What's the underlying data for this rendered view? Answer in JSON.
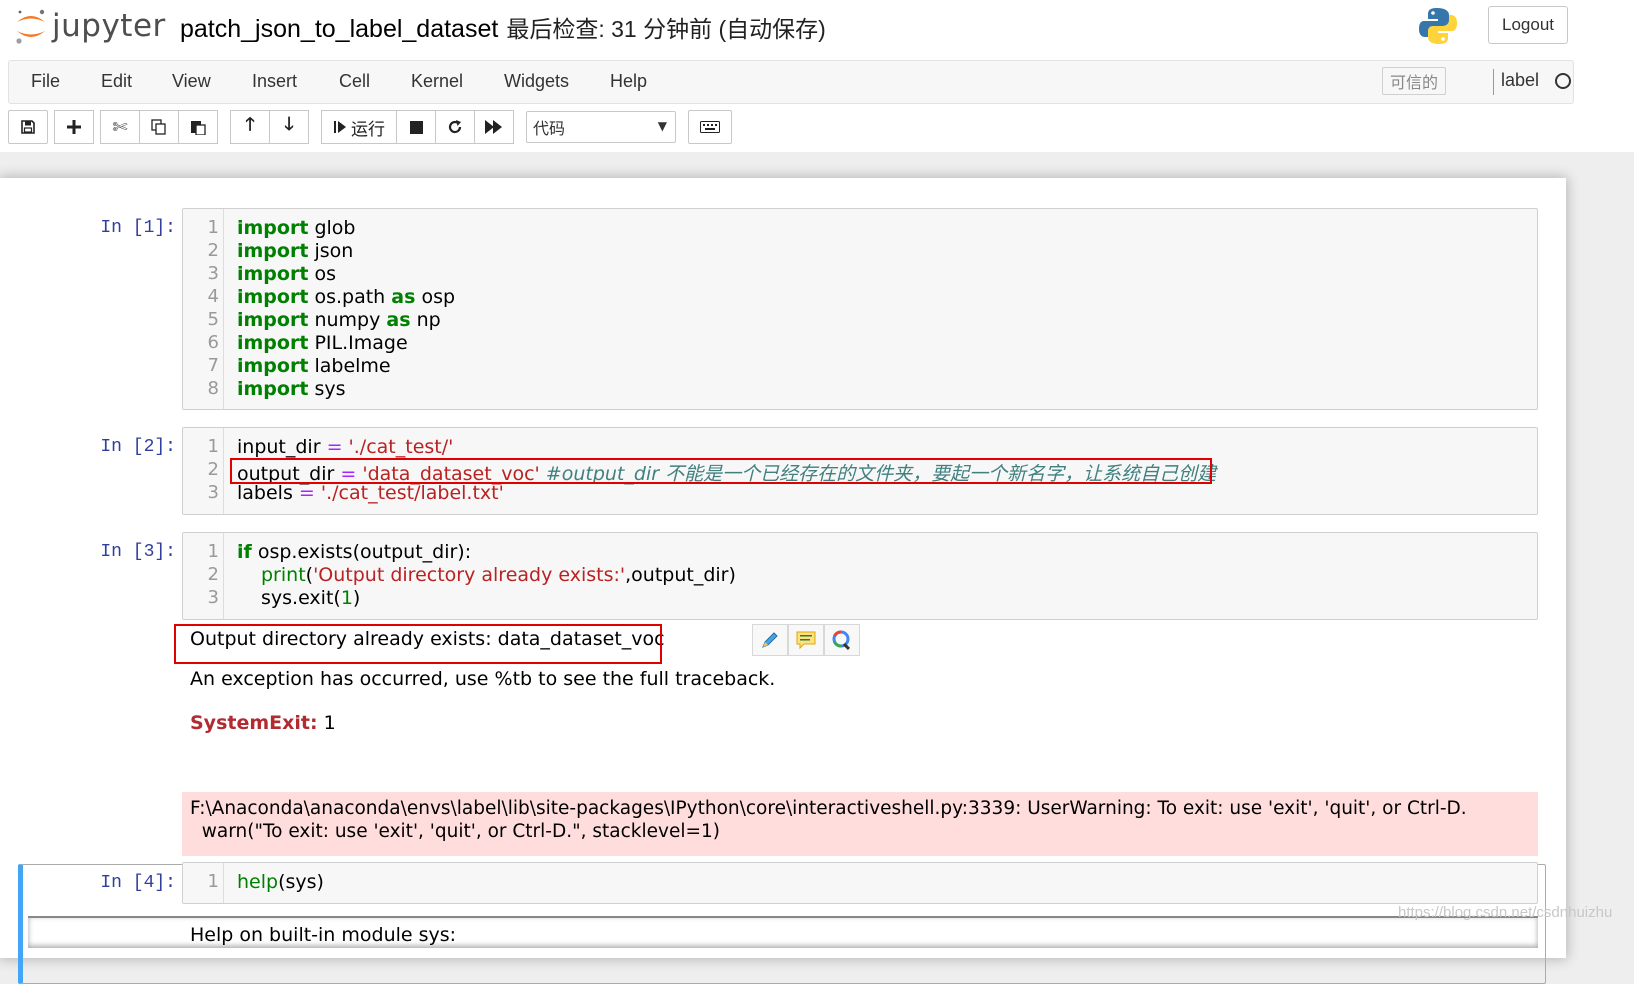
{
  "header": {
    "logo_text": "jupyter",
    "notebook_name": "patch_json_to_label_dataset",
    "save_status": "最后检查: 31 分钟前  (自动保存)",
    "logout_label": "Logout"
  },
  "menubar": {
    "items": [
      "File",
      "Edit",
      "View",
      "Insert",
      "Cell",
      "Kernel",
      "Widgets",
      "Help"
    ],
    "trusted_label": "可信的",
    "kernel_name": "label"
  },
  "toolbar": {
    "run_label": "运行",
    "cell_type": "代码",
    "icons": [
      "save-icon",
      "plus-icon",
      "scissors-icon",
      "copy-icon",
      "paste-icon",
      "arrow-up-icon",
      "arrow-down-icon",
      "step-icon",
      "stop-icon",
      "restart-icon",
      "fast-forward-icon",
      "keyboard-icon"
    ]
  },
  "cells": [
    {
      "prompt": "In [1]:",
      "lines": [
        {
          "n": "1",
          "kw": "import",
          "rest": " glob"
        },
        {
          "n": "2",
          "kw": "import",
          "rest": " json"
        },
        {
          "n": "3",
          "kw": "import",
          "rest": " os"
        },
        {
          "n": "4",
          "kw": "import",
          "mid": " os.path ",
          "kw2": "as",
          "rest": " osp"
        },
        {
          "n": "5",
          "kw": "import",
          "mid": " numpy ",
          "kw2": "as",
          "rest": " np"
        },
        {
          "n": "6",
          "kw": "import",
          "rest": " PIL.Image"
        },
        {
          "n": "7",
          "kw": "import",
          "rest": " labelme"
        },
        {
          "n": "8",
          "kw": "import",
          "rest": " sys"
        }
      ]
    },
    {
      "prompt": "In [2]:",
      "lines": [
        {
          "n": "1",
          "var": "input_dir",
          "op": "=",
          "str": "'./cat_test/'"
        },
        {
          "n": "2",
          "var": "output_dir",
          "op": "=",
          "str": "'data_dataset_voc'",
          "cmt": "#output_dir 不能是一个已经存在的文件夹，要起一个新名字，让系统自己创建"
        },
        {
          "n": "3",
          "var": "labels",
          "op": "=",
          "str": "'./cat_test/label.txt'"
        }
      ]
    },
    {
      "prompt": "In [3]:",
      "lines": [
        {
          "n": "1",
          "kw": "if",
          "rest": " osp.exists(output_dir):"
        },
        {
          "n": "2",
          "fn": "print",
          "open": "(",
          "str": "'Output directory already exists:'",
          "rest": ",output_dir)"
        },
        {
          "n": "3",
          "rest": "sys.exit(",
          "num": "1",
          "close": ")"
        }
      ],
      "outputs": {
        "stdout": "Output directory already exists: data_dataset_voc",
        "exception_note": "An exception has occurred, use %tb to see the full traceback.",
        "exception_name": "SystemExit:",
        "exception_value": " 1",
        "stderr_line1": "F:\\Anaconda\\anaconda\\envs\\label\\lib\\site-packages\\IPython\\core\\interactiveshell.py:3339: UserWarning: To exit: use 'exit', 'quit', or Ctrl-D.",
        "stderr_line2": "  warn(\"To exit: use 'exit', 'quit', or Ctrl-D.\", stacklevel=1)"
      }
    },
    {
      "prompt": "In [4]:",
      "lines": [
        {
          "n": "1",
          "fn": "help",
          "open": "(",
          "rest": "sys",
          "close": ")"
        }
      ],
      "output_partial": "Help on built-in module sys:"
    }
  ],
  "watermark": "https://blog.csdn.net/csdnhuizhu"
}
